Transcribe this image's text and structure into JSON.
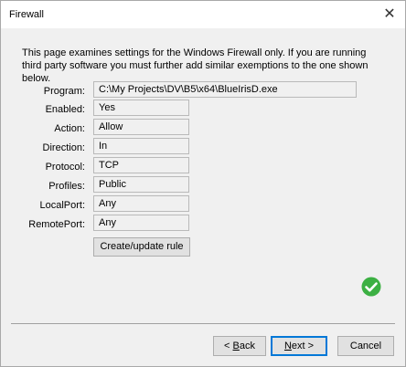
{
  "window": {
    "title": "Firewall",
    "close_glyph": "✕"
  },
  "description": "This page examines settings for the Windows Firewall only.  If you are running third party software you must further add similar exemptions to the one shown below.",
  "fields": {
    "program": {
      "label": "Program:",
      "value": "C:\\My Projects\\DV\\B5\\x64\\BlueIrisD.exe"
    },
    "enabled": {
      "label": "Enabled:",
      "value": "Yes"
    },
    "action": {
      "label": "Action:",
      "value": "Allow"
    },
    "direction": {
      "label": "Direction:",
      "value": "In"
    },
    "protocol": {
      "label": "Protocol:",
      "value": "TCP"
    },
    "profiles": {
      "label": "Profiles:",
      "value": "Public"
    },
    "localport": {
      "label": "LocalPort:",
      "value": "Any"
    },
    "remoteport": {
      "label": "RemotePort:",
      "value": "Any"
    }
  },
  "buttons": {
    "create_update": "Create/update rule",
    "back_prefix": "< ",
    "back_accel": "B",
    "back_rest": "ack",
    "next_accel": "N",
    "next_rest": "ext >",
    "cancel": "Cancel"
  },
  "status": {
    "icon": "check-circle-icon",
    "color": "#3cb043"
  }
}
